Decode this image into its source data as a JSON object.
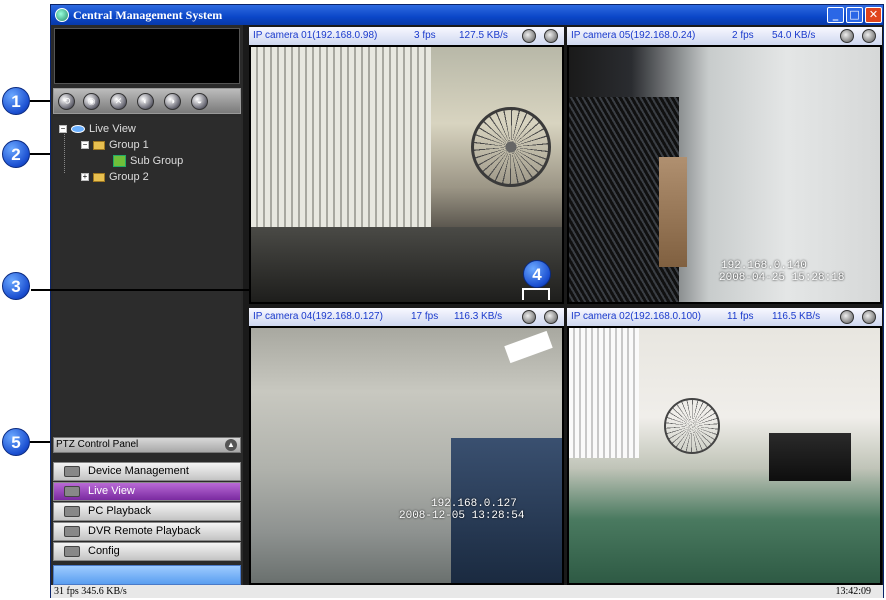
{
  "window": {
    "title": "Central Management System",
    "controls": {
      "minimize": "_",
      "maximize": "□",
      "close": "✕"
    }
  },
  "callouts": [
    "1",
    "2",
    "3",
    "4",
    "5"
  ],
  "toolbar": {
    "buttons": [
      "toolbar-button-1-icon",
      "toolbar-button-2-icon",
      "toolbar-button-3-icon",
      "toolbar-button-4-icon",
      "toolbar-button-5-icon",
      "toolbar-button-6-icon"
    ]
  },
  "tree": {
    "root": "Live View",
    "group1": "Group 1",
    "subgroup": "Sub Group",
    "group2": "Group 2"
  },
  "ptz": {
    "label": "PTZ Control Panel",
    "icon": "chevron-up-icon"
  },
  "nav": [
    {
      "label": "Device Management",
      "icon": "device-icon"
    },
    {
      "label": "Live View",
      "icon": "camera-icon"
    },
    {
      "label": "PC Playback",
      "icon": "playback-icon"
    },
    {
      "label": "DVR Remote Playback",
      "icon": "dvr-icon"
    },
    {
      "label": "Config",
      "icon": "config-icon"
    }
  ],
  "status": {
    "left": "31 fps 345.6 KB/s",
    "right": "13:42:09"
  },
  "cameras": [
    {
      "name": "IP camera 01(192.168.0.98)",
      "fps": "3 fps",
      "rate": "127.5 KB/s",
      "osd1": "",
      "osd2": ""
    },
    {
      "name": "IP camera 05(192.168.0.24)",
      "fps": "2 fps",
      "rate": "54.0 KB/s",
      "osd1": "192.168.0.140",
      "osd2": "2008-04-25 15:28:18"
    },
    {
      "name": "IP camera 04(192.168.0.127)",
      "fps": "17 fps",
      "rate": "116.3 KB/s",
      "osd1": "192.168.0.127",
      "osd2": "2008-12-05 13:28:54"
    },
    {
      "name": "IP camera 02(192.168.0.100)",
      "fps": "11 fps",
      "rate": "116.5 KB/s",
      "osd1": "",
      "osd2": ""
    }
  ]
}
